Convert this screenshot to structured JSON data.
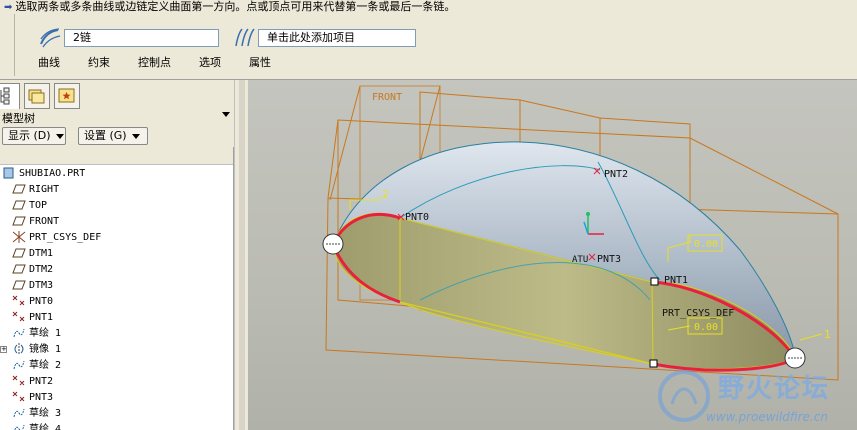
{
  "dashboard": {
    "message": "选取两条或多条曲线或边链定义曲面第一方向。点或顶点可用来代替第一条或最后一条链。",
    "collector_first": "2链",
    "collector_second": "单击此处添加项目",
    "tabs": [
      "曲线",
      "约束",
      "控制点",
      "选项",
      "属性"
    ]
  },
  "model_tree": {
    "title": "模型树",
    "show_button": "显示 (D)",
    "settings_button": "设置 (G)",
    "items": [
      {
        "label": "SHUBIAO.PRT",
        "icon": "part-icon"
      },
      {
        "label": "RIGHT",
        "icon": "datum-plane-icon"
      },
      {
        "label": "TOP",
        "icon": "datum-plane-icon"
      },
      {
        "label": "FRONT",
        "icon": "datum-plane-icon"
      },
      {
        "label": "PRT_CSYS_DEF",
        "icon": "csys-icon"
      },
      {
        "label": "DTM1",
        "icon": "datum-plane-icon"
      },
      {
        "label": "DTM2",
        "icon": "datum-plane-icon"
      },
      {
        "label": "DTM3",
        "icon": "datum-plane-icon"
      },
      {
        "label": "PNT0",
        "icon": "datum-point-icon"
      },
      {
        "label": "PNT1",
        "icon": "datum-point-icon"
      },
      {
        "label": "草绘 1",
        "icon": "sketch-icon"
      },
      {
        "label": "镜像 1",
        "icon": "mirror-icon"
      },
      {
        "label": "草绘 2",
        "icon": "sketch-icon"
      },
      {
        "label": "PNT2",
        "icon": "datum-point-icon"
      },
      {
        "label": "PNT3",
        "icon": "datum-point-icon"
      },
      {
        "label": "草绘 3",
        "icon": "sketch-icon"
      },
      {
        "label": "草绘 4",
        "icon": "sketch-icon"
      }
    ]
  },
  "viewport": {
    "labels": {
      "front": "FRONT",
      "pnt0": "PNT0",
      "pnt1": "PNT1",
      "pnt2": "PNT2",
      "pnt3": "PNT3",
      "csys": "PRT_CSYS_DEF",
      "dim_top": "0.00",
      "dim_bottom": "0.00",
      "chain_2": "2",
      "chain_1": "1",
      "atu": "ATU"
    },
    "colors": {
      "datum": "#c8781e",
      "chain_highlight": "#e8203c",
      "selection": "#e8e020",
      "surface": "#a9b6c4"
    }
  },
  "watermark": {
    "text": "野火论坛",
    "url": "www.proewildfire.cn"
  }
}
